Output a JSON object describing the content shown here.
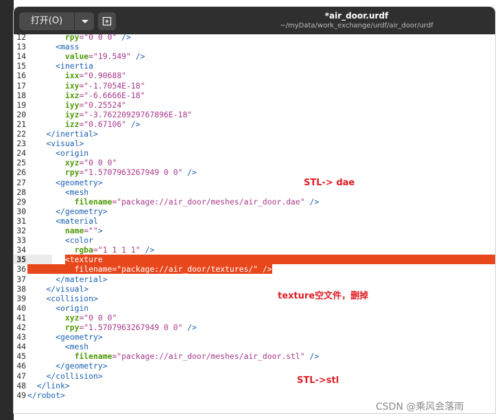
{
  "titlebar": {
    "open_label": "打开(O)",
    "title": "*air_door.urdf",
    "path": "~/myData/work_exchange/urdf/air_door/urdf"
  },
  "lines": [
    {
      "n": "12",
      "parts": [
        [
          "plain",
          "        "
        ],
        [
          "attr",
          "rpy"
        ],
        [
          "str",
          "=\"0 0 0\""
        ],
        [
          "tag",
          " />"
        ]
      ]
    },
    {
      "n": "13",
      "parts": [
        [
          "plain",
          "      "
        ],
        [
          "tag",
          "<mass"
        ]
      ]
    },
    {
      "n": "14",
      "parts": [
        [
          "plain",
          "        "
        ],
        [
          "attr",
          "value"
        ],
        [
          "str",
          "=\"19.549\""
        ],
        [
          "tag",
          " />"
        ]
      ]
    },
    {
      "n": "15",
      "parts": [
        [
          "plain",
          "      "
        ],
        [
          "tag",
          "<inertia"
        ]
      ]
    },
    {
      "n": "16",
      "parts": [
        [
          "plain",
          "        "
        ],
        [
          "attr",
          "ixx"
        ],
        [
          "str",
          "=\"0.90688\""
        ]
      ]
    },
    {
      "n": "17",
      "parts": [
        [
          "plain",
          "        "
        ],
        [
          "attr",
          "ixy"
        ],
        [
          "str",
          "=\"-1.7054E-18\""
        ]
      ]
    },
    {
      "n": "18",
      "parts": [
        [
          "plain",
          "        "
        ],
        [
          "attr",
          "ixz"
        ],
        [
          "str",
          "=\"-6.6666E-18\""
        ]
      ]
    },
    {
      "n": "19",
      "parts": [
        [
          "plain",
          "        "
        ],
        [
          "attr",
          "iyy"
        ],
        [
          "str",
          "=\"0.25524\""
        ]
      ]
    },
    {
      "n": "20",
      "parts": [
        [
          "plain",
          "        "
        ],
        [
          "attr",
          "iyz"
        ],
        [
          "str",
          "=\"-3.76220929767896E-18\""
        ]
      ]
    },
    {
      "n": "21",
      "parts": [
        [
          "plain",
          "        "
        ],
        [
          "attr",
          "izz"
        ],
        [
          "str",
          "=\"0.67106\""
        ],
        [
          "tag",
          " />"
        ]
      ]
    },
    {
      "n": "22",
      "parts": [
        [
          "plain",
          "    "
        ],
        [
          "tag",
          "</inertial>"
        ]
      ]
    },
    {
      "n": "23",
      "parts": [
        [
          "plain",
          "    "
        ],
        [
          "tag",
          "<visual>"
        ]
      ]
    },
    {
      "n": "24",
      "parts": [
        [
          "plain",
          "      "
        ],
        [
          "tag",
          "<origin"
        ]
      ]
    },
    {
      "n": "25",
      "parts": [
        [
          "plain",
          "        "
        ],
        [
          "attr",
          "xyz"
        ],
        [
          "str",
          "=\"0 0 0\""
        ]
      ]
    },
    {
      "n": "26",
      "parts": [
        [
          "plain",
          "        "
        ],
        [
          "attr",
          "rpy"
        ],
        [
          "str",
          "=\"1.5707963267949 0 0\""
        ],
        [
          "tag",
          " />"
        ]
      ]
    },
    {
      "n": "27",
      "parts": [
        [
          "plain",
          "      "
        ],
        [
          "tag",
          "<geometry>"
        ]
      ]
    },
    {
      "n": "28",
      "parts": [
        [
          "plain",
          "        "
        ],
        [
          "tag",
          "<mesh"
        ]
      ]
    },
    {
      "n": "29",
      "parts": [
        [
          "plain",
          "          "
        ],
        [
          "attr",
          "filename"
        ],
        [
          "str",
          "=\"package://air_door/meshes/air_door.dae\""
        ],
        [
          "tag",
          " />"
        ]
      ]
    },
    {
      "n": "30",
      "parts": [
        [
          "plain",
          "      "
        ],
        [
          "tag",
          "</geometry>"
        ]
      ]
    },
    {
      "n": "31",
      "parts": [
        [
          "plain",
          "      "
        ],
        [
          "tag",
          "<material"
        ]
      ]
    },
    {
      "n": "32",
      "parts": [
        [
          "plain",
          "        "
        ],
        [
          "attr",
          "name"
        ],
        [
          "str",
          "=\"\""
        ],
        [
          "tag",
          ">"
        ]
      ]
    },
    {
      "n": "33",
      "parts": [
        [
          "plain",
          "        "
        ],
        [
          "tag",
          "<color"
        ]
      ]
    },
    {
      "n": "34",
      "parts": [
        [
          "plain",
          "          "
        ],
        [
          "attr",
          "rgba"
        ],
        [
          "str",
          "=\"1 1 1 1\""
        ],
        [
          "tag",
          " />"
        ]
      ]
    },
    {
      "n": "35",
      "parts": [
        [
          "plain",
          "        "
        ],
        [
          "tag",
          "<texture"
        ]
      ]
    },
    {
      "n": "36",
      "parts": [
        [
          "plain",
          "          "
        ],
        [
          "attr",
          "filename"
        ],
        [
          "str",
          "=\"package://air_door/textures/\""
        ],
        [
          "tag",
          " />"
        ]
      ]
    },
    {
      "n": "37",
      "parts": [
        [
          "plain",
          "      "
        ],
        [
          "tag",
          "</material>"
        ]
      ]
    },
    {
      "n": "38",
      "parts": [
        [
          "plain",
          "    "
        ],
        [
          "tag",
          "</visual>"
        ]
      ]
    },
    {
      "n": "39",
      "parts": [
        [
          "plain",
          "    "
        ],
        [
          "tag",
          "<collision>"
        ]
      ]
    },
    {
      "n": "40",
      "parts": [
        [
          "plain",
          "      "
        ],
        [
          "tag",
          "<origin"
        ]
      ]
    },
    {
      "n": "41",
      "parts": [
        [
          "plain",
          "        "
        ],
        [
          "attr",
          "xyz"
        ],
        [
          "str",
          "=\"0 0 0\""
        ]
      ]
    },
    {
      "n": "42",
      "parts": [
        [
          "plain",
          "        "
        ],
        [
          "attr",
          "rpy"
        ],
        [
          "str",
          "=\"1.5707963267949 0 0\""
        ],
        [
          "tag",
          " />"
        ]
      ]
    },
    {
      "n": "43",
      "parts": [
        [
          "plain",
          "      "
        ],
        [
          "tag",
          "<geometry>"
        ]
      ]
    },
    {
      "n": "44",
      "parts": [
        [
          "plain",
          "        "
        ],
        [
          "tag",
          "<mesh"
        ]
      ]
    },
    {
      "n": "45",
      "parts": [
        [
          "plain",
          "          "
        ],
        [
          "attr",
          "filename"
        ],
        [
          "str",
          "=\"package://air_door/meshes/air_door.stl\""
        ],
        [
          "tag",
          " />"
        ]
      ]
    },
    {
      "n": "46",
      "parts": [
        [
          "plain",
          "      "
        ],
        [
          "tag",
          "</geometry>"
        ]
      ]
    },
    {
      "n": "47",
      "parts": [
        [
          "plain",
          "    "
        ],
        [
          "tag",
          "</collision>"
        ]
      ]
    },
    {
      "n": "48",
      "parts": [
        [
          "plain",
          "  "
        ],
        [
          "tag",
          "</link>"
        ]
      ]
    },
    {
      "n": "49",
      "parts": [
        [
          "tag",
          "</robot>"
        ]
      ]
    }
  ],
  "current_line": "35",
  "selected_lines": [
    "35",
    "36"
  ],
  "annotations": {
    "dae": "STL-> dae",
    "texture": "texture空文件，删掉",
    "stl": "STL->stl"
  },
  "watermark": "CSDN @乘风会落雨",
  "colors": {
    "selection": "#e8471c",
    "annotation": "#e01b24",
    "tag": "#1a5fb4",
    "attribute": "#4e9a06",
    "string": "#a8388a"
  }
}
